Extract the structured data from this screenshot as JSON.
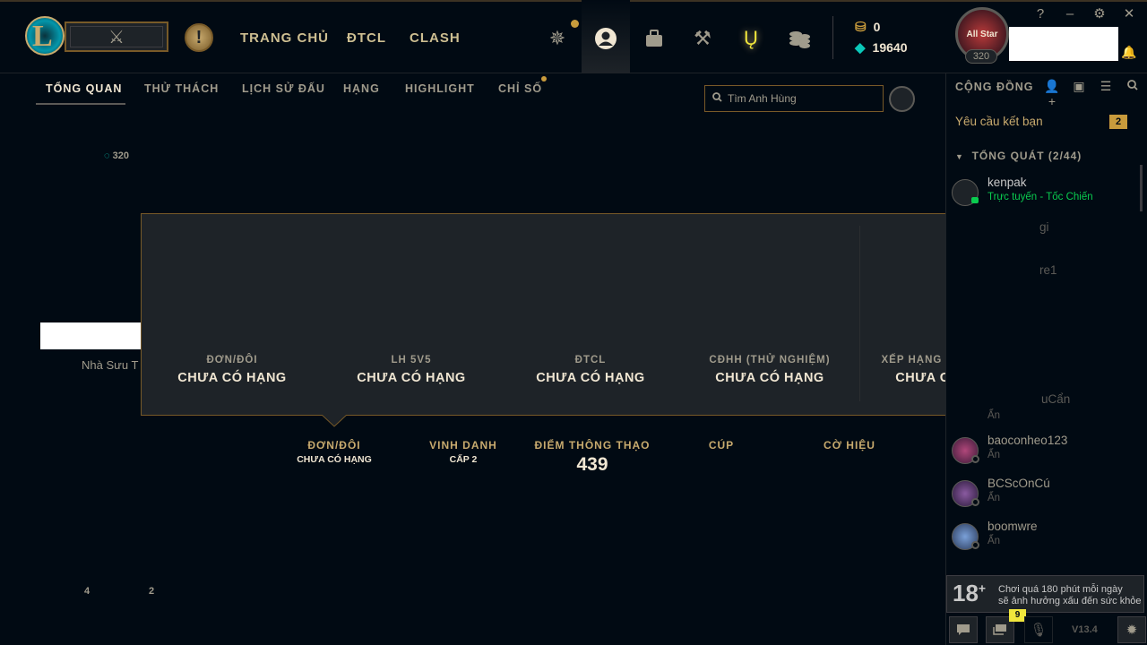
{
  "topbar": {
    "nav": [
      "TRANG CHỦ",
      "ĐTCL",
      "CLASH"
    ],
    "currency": {
      "rp": "0",
      "blue_essence": "19640"
    },
    "level": "320",
    "avatar_text": "All Star",
    "window_buttons": [
      "?",
      "–",
      "⚙",
      "✕"
    ]
  },
  "subnav": {
    "items": [
      "TỔNG QUAN",
      "THỬ THÁCH",
      "LỊCH SỬ ĐẤU",
      "HẠNG",
      "HIGHLIGHT",
      "CHỈ SỐ"
    ],
    "search_placeholder": "Tìm Anh Hùng"
  },
  "profile": {
    "level_indicator": "320",
    "collector_text": "Nhà Sưu T",
    "stat_a": "4",
    "stat_b": "2"
  },
  "rank_popup": {
    "queues": [
      {
        "name": "ĐƠN/ĐÔI",
        "rank": "CHƯA CÓ HẠNG"
      },
      {
        "name": "LH 5V5",
        "rank": "CHƯA CÓ HẠNG"
      },
      {
        "name": "ĐTCL",
        "rank": "CHƯA CÓ HẠNG"
      },
      {
        "name": "CĐHH (THỬ NGHIỆM)",
        "rank": "CHƯA CÓ HẠNG"
      },
      {
        "name": "XẾP HẠNG MÙA TRƯỚC",
        "rank": "CHƯA CÓ HẠNG"
      }
    ]
  },
  "bottom_stats": [
    {
      "title": "ĐƠN/ĐÔI",
      "value": "CHƯA CÓ HẠNG"
    },
    {
      "title": "VINH DANH",
      "value": "CẤP 2"
    },
    {
      "title": "ĐIỂM THÔNG THẠO",
      "value": "439"
    },
    {
      "title": "CÚP",
      "value": ""
    },
    {
      "title": "CỜ HIỆU",
      "value": ""
    }
  ],
  "social": {
    "title": "CỘNG ĐỒNG",
    "friend_requests_label": "Yêu cầu kết bạn",
    "friend_requests_count": "2",
    "group_header": "TỔNG QUÁT (2/44)",
    "friends": [
      {
        "name": "kenpak",
        "status": "Trực tuyến - Tốc Chiến"
      },
      {
        "name": "baoconheo123",
        "status": "Ẩn"
      },
      {
        "name": "BCScOnCú",
        "status": "Ẩn"
      },
      {
        "name": "boomwre",
        "status": "Ẩn"
      }
    ],
    "partial_names": [
      "gi",
      "re1",
      "uCẩn",
      "Ẩn"
    ]
  },
  "age_warning": {
    "badge": "18",
    "text_line1": "Chơi quá 180 phút mỗi ngày",
    "text_line2": "sẽ ảnh hưởng xấu đến sức khỏe"
  },
  "bottom_bar": {
    "chat_badge": "9",
    "version": "V13.4"
  },
  "colors": {
    "gold": "#c8aa6e",
    "gold_dark": "#785a28",
    "bg": "#010a13",
    "panel": "#1e2328",
    "online": "#0acb4f"
  }
}
